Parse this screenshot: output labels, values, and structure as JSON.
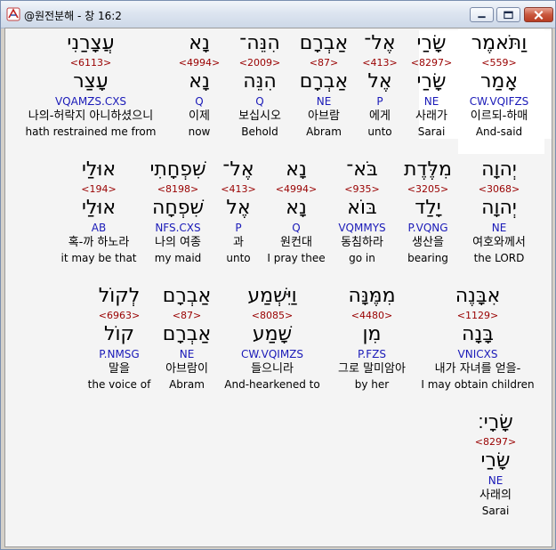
{
  "window": {
    "title": "@원전분해 - 창 16:2"
  },
  "rows": [
    {
      "words": [
        {
          "heb": "וַתֹּאמֶר",
          "strong": "<559>",
          "lemma": "אָמַר",
          "morph": "CW.VQIFZS",
          "korean": "이르되-하매",
          "english": "And-said",
          "center": 559,
          "selected": true
        },
        {
          "heb": "שָׂרַי",
          "strong": "<8297>",
          "lemma": "שָׂרַי",
          "morph": "NE",
          "korean": "사래가",
          "english": "Sarai",
          "center": 483
        },
        {
          "heb": "אֶל־",
          "strong": "<413>",
          "lemma": "אֶל",
          "morph": "P",
          "korean": "에게",
          "english": "unto",
          "center": 425
        },
        {
          "heb": "אַבְרָם",
          "strong": "<87>",
          "lemma": "אַבְרָם",
          "morph": "NE",
          "korean": "아브람",
          "english": "Abram",
          "center": 362
        },
        {
          "heb": "הִנֵּה־",
          "strong": "<2009>",
          "lemma": "הִנֵּה",
          "morph": "Q",
          "korean": "보십시오",
          "english": "Behold",
          "center": 290
        },
        {
          "heb": "נָא",
          "strong": "<4994>",
          "lemma": "נָא",
          "morph": "Q",
          "korean": "이제",
          "english": "now",
          "center": 222
        },
        {
          "heb": "עֲצָרַנִי",
          "strong": "<6113>",
          "lemma": "עָצַר",
          "morph": "VQAMZS.CXS",
          "korean": "나의-허락지 아니하셨으니",
          "english": "hath restrained me from",
          "center": 100
        }
      ]
    },
    {
      "words": [
        {
          "heb": "יְהוָה",
          "strong": "<3068>",
          "lemma": "יְהוָה",
          "morph": "NE",
          "korean": "여호와께서",
          "english": "the LORD",
          "center": 559
        },
        {
          "heb": "מִלֶּדֶת",
          "strong": "<3205>",
          "lemma": "יָלַד",
          "morph": "P.VQNG",
          "korean": "생산을",
          "english": "bearing",
          "center": 479
        },
        {
          "heb": "בֹּא־",
          "strong": "<935>",
          "lemma": "בּוֹא",
          "morph": "VQMMYS",
          "korean": "동침하라",
          "english": "go in",
          "center": 405
        },
        {
          "heb": "נָא",
          "strong": "<4994>",
          "lemma": "נָא",
          "morph": "Q",
          "korean": "원컨대",
          "english": "I pray thee",
          "center": 331
        },
        {
          "heb": "אֶל־",
          "strong": "<413>",
          "lemma": "אֶל",
          "morph": "P",
          "korean": "과",
          "english": "unto",
          "center": 266
        },
        {
          "heb": "שִׁפְחָתִי",
          "strong": "<8198>",
          "lemma": "שִׁפְחָה",
          "morph": "NFS.CXS",
          "korean": "나의 여종",
          "english": "my maid",
          "center": 198
        },
        {
          "heb": "אוּלַי",
          "strong": "<194>",
          "lemma": "אוּלַי",
          "morph": "AB",
          "korean": "혹-까 하노라",
          "english": "it may be that",
          "center": 109
        }
      ]
    },
    {
      "words": [
        {
          "heb": "אִבָּנֶה",
          "strong": "<1129>",
          "lemma": "בָּנָה",
          "morph": "VNICXS",
          "korean": "내가 자녀를 얻을-",
          "english": "I may obtain children",
          "center": 535
        },
        {
          "heb": "מִמֶּנָּה",
          "strong": "<4480>",
          "lemma": "מִן",
          "morph": "P.FZS",
          "korean": "그로 말미암아",
          "english": "by her",
          "center": 416
        },
        {
          "heb": "וַיִּשְׁמַע",
          "strong": "<8085>",
          "lemma": "שָׁמַע",
          "morph": "CW.VQIMZS",
          "korean": "들으니라",
          "english": "And-hearkened to",
          "center": 304
        },
        {
          "heb": "אַבְרָם",
          "strong": "<87>",
          "lemma": "אַבְרָם",
          "morph": "NE",
          "korean": "아브람이",
          "english": "Abram",
          "center": 208
        },
        {
          "heb": "לְקוֹל",
          "strong": "<6963>",
          "lemma": "קוֹל",
          "morph": "P.NMSG",
          "korean": "말을",
          "english": "the voice of",
          "center": 132
        }
      ]
    },
    {
      "words": [
        {
          "heb": "שָׂרָי׃",
          "strong": "<8297>",
          "lemma": "שָׂרַי",
          "morph": "NE",
          "korean": "사래의",
          "english": "Sarai",
          "center": 555
        }
      ]
    }
  ],
  "colors": {
    "strong": "#990000",
    "morph": "#1a1ab8",
    "titlebar": "#dde5f0",
    "close": "#c9573d"
  },
  "icons": {
    "app": "app-logo-icon",
    "minimize": "minimize-icon",
    "maximize": "maximize-icon",
    "close": "close-icon"
  }
}
